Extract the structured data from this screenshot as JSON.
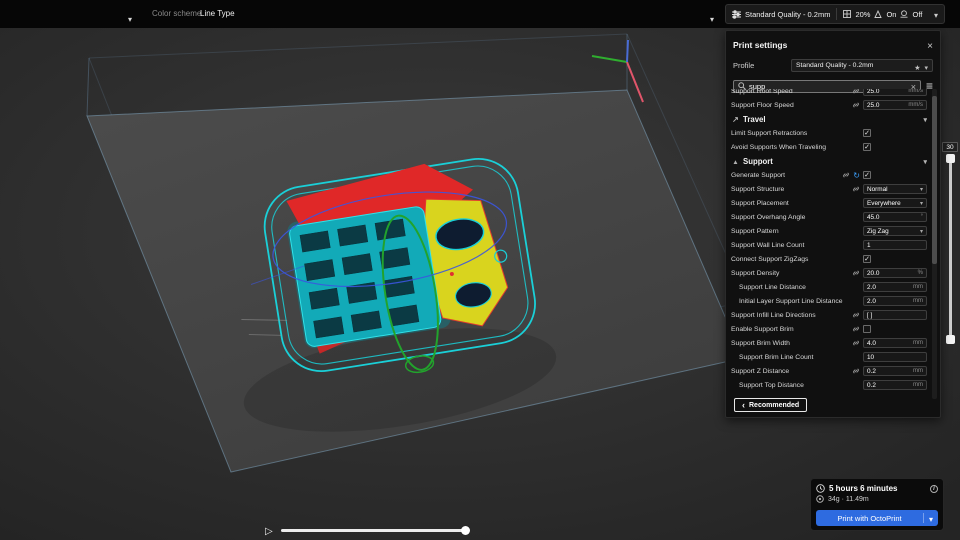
{
  "topbar": {
    "color_scheme_label": "Color scheme",
    "color_scheme_value": "Line Type",
    "setup": {
      "profile": "Standard Quality - 0.2mm",
      "infill": "20%",
      "support_state": "On",
      "adhesion_state": "Off"
    }
  },
  "panel": {
    "title": "Print settings",
    "profile_label": "Profile",
    "profile_value": "Standard Quality - 0.2mm",
    "search_value": "supp",
    "recommended_label": "Recommended",
    "rows": [
      {
        "type": "value",
        "label": "Support Roof Speed",
        "value": "25.0",
        "unit": "mm/s",
        "link": true
      },
      {
        "type": "value",
        "label": "Support Floor Speed",
        "value": "25.0",
        "unit": "mm/s",
        "link": true
      },
      {
        "type": "header",
        "label": "Travel",
        "icon": true
      },
      {
        "type": "check",
        "label": "Limit Support Retractions",
        "checked": true
      },
      {
        "type": "check",
        "label": "Avoid Supports When Traveling",
        "checked": true
      },
      {
        "type": "header",
        "label": "Support",
        "icon": true
      },
      {
        "type": "check",
        "label": "Generate Support",
        "checked": true,
        "link": true,
        "revert": true
      },
      {
        "type": "dropdown",
        "label": "Support Structure",
        "value": "Normal",
        "link": true
      },
      {
        "type": "dropdown",
        "label": "Support Placement",
        "value": "Everywhere"
      },
      {
        "type": "value",
        "label": "Support Overhang Angle",
        "value": "45.0",
        "unit": "°"
      },
      {
        "type": "dropdown",
        "label": "Support Pattern",
        "value": "Zig Zag"
      },
      {
        "type": "value",
        "label": "Support Wall Line Count",
        "value": "1",
        "unit": ""
      },
      {
        "type": "check",
        "label": "Connect Support ZigZags",
        "checked": true
      },
      {
        "type": "value",
        "label": "Support Density",
        "value": "20.0",
        "unit": "%",
        "link": true
      },
      {
        "type": "value",
        "label": "Support Line Distance",
        "value": "2.0",
        "unit": "mm",
        "indent": 1
      },
      {
        "type": "value",
        "label": "Initial Layer Support Line Distance",
        "value": "2.0",
        "unit": "mm",
        "indent": 1
      },
      {
        "type": "value",
        "label": "Support Infill Line Directions",
        "value": "[ ]",
        "unit": "",
        "link": true
      },
      {
        "type": "check",
        "label": "Enable Support Brim",
        "checked": false,
        "link": true
      },
      {
        "type": "value",
        "label": "Support Brim Width",
        "value": "4.0",
        "unit": "mm",
        "link": true
      },
      {
        "type": "value",
        "label": "Support Brim Line Count",
        "value": "10",
        "unit": "",
        "indent": 1
      },
      {
        "type": "value",
        "label": "Support Z Distance",
        "value": "0.2",
        "unit": "mm",
        "link": true
      },
      {
        "type": "value",
        "label": "Support Top Distance",
        "value": "0.2",
        "unit": "mm",
        "indent": 1
      }
    ]
  },
  "layer_slider": {
    "value": "30"
  },
  "summary": {
    "time": "5 hours 6 minutes",
    "material": "34g · 11.49m",
    "print_button_label": "Print with OctoPrint"
  },
  "colors": {
    "accent_blue": "#2e6be0",
    "support_teal": "#1ad0d8",
    "outer_wall_red": "#e02828",
    "skin_yellow": "#d9d41e",
    "inner_wall_green": "#22a32c",
    "travel_blue": "#3b55e0"
  }
}
